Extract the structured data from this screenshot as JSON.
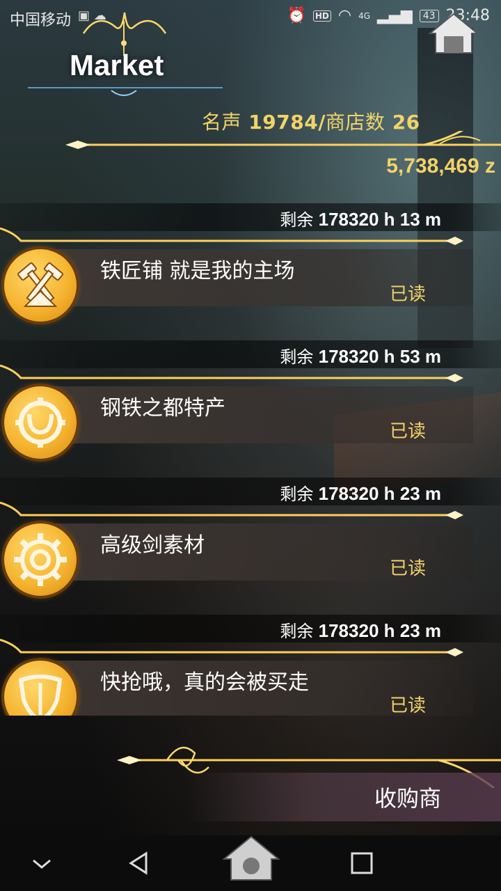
{
  "status_bar": {
    "carrier": "中国移动",
    "network": "4G",
    "battery": "43",
    "time": "23:48"
  },
  "header": {
    "title": "Market",
    "fame_label": "名声",
    "fame_value": "19784",
    "separator": "/",
    "shops_label": "商店数",
    "shops_value": "26",
    "money": "5,738,469 z"
  },
  "listings": [
    {
      "timer_label": "剩余",
      "timer": "178320 h 13 m",
      "title": "铁匠铺 就是我的主场",
      "status": "已读",
      "icon": "hammers-icon"
    },
    {
      "timer_label": "剩余",
      "timer": "178320 h 53 m",
      "title": "钢铁之都特产",
      "status": "已读",
      "icon": "horseshoe-gear-icon"
    },
    {
      "timer_label": "剩余",
      "timer": "178320 h 23 m",
      "title": "高级剑素材",
      "status": "已读",
      "icon": "gear-icon"
    },
    {
      "timer_label": "剩余",
      "timer": "178320 h 23 m",
      "title": "快抢哦，真的会被买走",
      "status": "已读",
      "icon": "shield-icon"
    }
  ],
  "footer": {
    "buyer_label": "收购商"
  },
  "colors": {
    "gold_text": "#f2d36a",
    "gold_line": "#ffcf5a",
    "badge": "#f5b430"
  }
}
